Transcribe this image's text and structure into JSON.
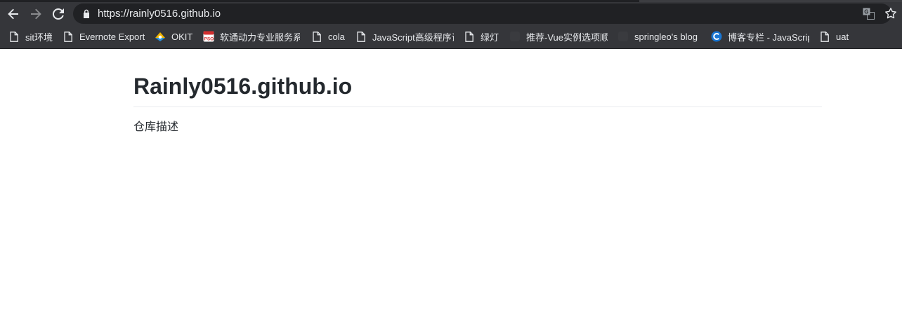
{
  "browser": {
    "address_bar": {
      "url": "https://rainly0516.github.io"
    },
    "nav": {
      "back_icon": "arrow-left-icon",
      "forward_icon": "arrow-right-icon",
      "reload_icon": "reload-icon"
    },
    "omnibox_icons": [
      "lock-icon",
      "translate-icon",
      "star-icon"
    ],
    "bookmarks": [
      {
        "label": "sit环境",
        "icon": "page-icon"
      },
      {
        "label": "Evernote Export",
        "icon": "page-icon"
      },
      {
        "label": "OKIT",
        "icon": "okit-favicon-icon"
      },
      {
        "label": "软通动力专业服务系统",
        "icon": "pso-favicon-icon"
      },
      {
        "label": "cola",
        "icon": "page-icon"
      },
      {
        "label": "JavaScript高级程序设计",
        "icon": "page-icon"
      },
      {
        "label": "绿灯",
        "icon": "page-icon"
      },
      {
        "label": "推荐-Vue实例选项顺序",
        "icon": "dark-favicon-icon"
      },
      {
        "label": "springleo's blog",
        "icon": "dark-favicon-icon"
      },
      {
        "label": "博客专栏 - JavaScript",
        "icon": "c-favicon-icon"
      },
      {
        "label": "uat",
        "icon": "page-icon"
      }
    ]
  },
  "page": {
    "title": "Rainly0516.github.io",
    "description": "仓库描述"
  },
  "colors": {
    "chrome_background": "#35363a",
    "omnibox_background": "#202124",
    "chrome_text": "#e8eaed",
    "page_text": "#24292e",
    "divider": "#eaecef"
  }
}
